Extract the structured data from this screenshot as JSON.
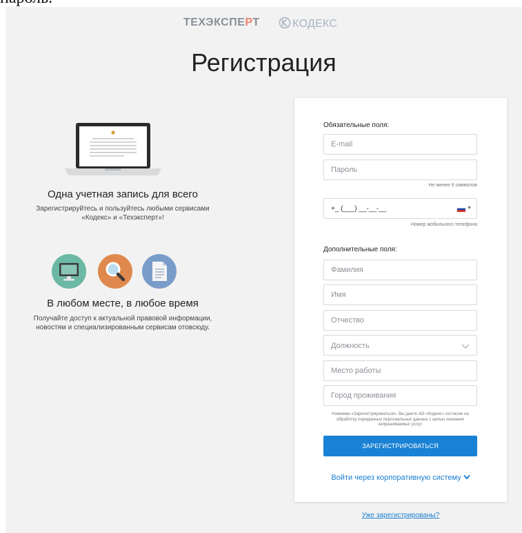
{
  "top_fragment": "пароль.",
  "logos": {
    "techexpert_left": "ТЕХЭКСПЕ",
    "techexpert_mark": "Р",
    "techexpert_right": "Т",
    "kodeks": "КОДЕКС"
  },
  "page_title": "Регистрация",
  "features": [
    {
      "title": "Одна учетная запись для всего",
      "desc": "Зарегистрируйтесь и пользуйтесь любыми сервисами «Кодекс» и «Техэксперт»!"
    },
    {
      "title": "В любом месте, в любое время",
      "desc": "Получайте доступ к актуальной правовой информации, новостям и специализированным сервисам отовсюду."
    }
  ],
  "feature_icons": [
    "monitor-icon",
    "magnifier-icon",
    "document-icon"
  ],
  "form": {
    "required_label": "Обязательные поля:",
    "email_placeholder": "E-mail",
    "password_placeholder": "Пароль",
    "password_hint": "Не менее 8 символов",
    "phone_mask": "+_ (___) __-__-__",
    "phone_hint": "Номер мобильного телефона",
    "optional_label": "Дополнительные поля:",
    "surname_placeholder": "Фамилия",
    "name_placeholder": "Имя",
    "patronymic_placeholder": "Отчество",
    "position_label": "Должность",
    "workplace_placeholder": "Место работы",
    "city_placeholder": "Город проживания",
    "consent": "Нажимая «Зарегистрироваться», Вы даете АО «Кодекс» согласие на обработку переданных персональных данных с целью оказания запрашиваемых услуг.",
    "submit_label": "ЗАРЕГИСТРИРОВАТЬСЯ",
    "corporate_link": "Войти через корпоративную систему"
  },
  "already_registered": "Уже зарегистрированы?",
  "colors": {
    "accent": "#1a82d4",
    "link": "#1a7fd1",
    "background": "#f2f2f2"
  }
}
